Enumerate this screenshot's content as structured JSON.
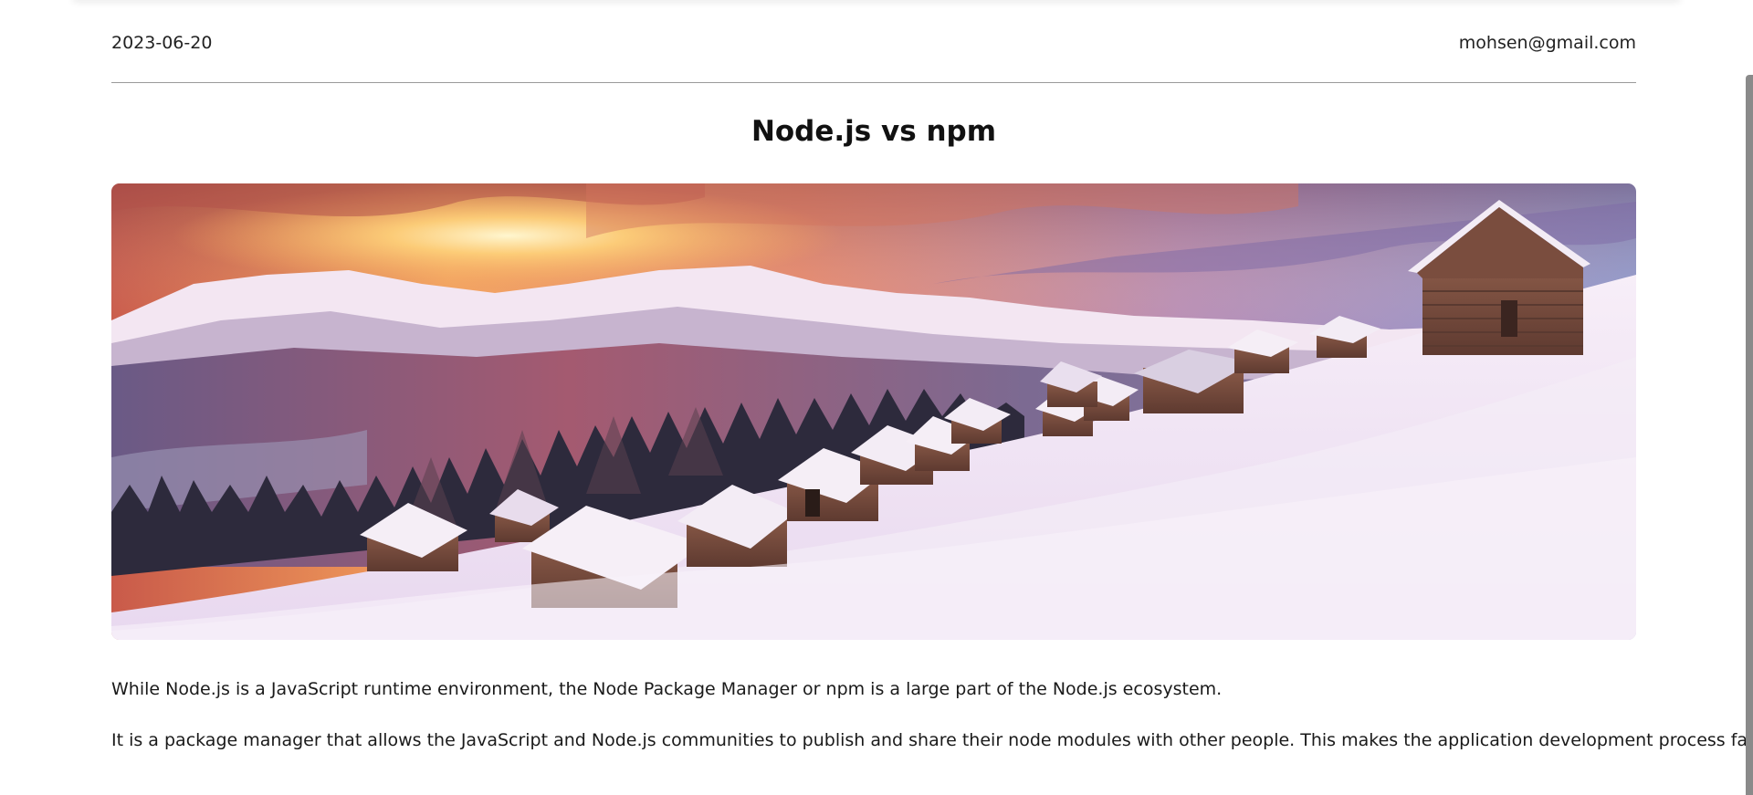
{
  "post": {
    "date": "2023-06-20",
    "author_email": "mohsen@gmail.com",
    "title": "Node.js vs npm",
    "hero_image": {
      "icon": "winter-mountain-cabins-image"
    },
    "paragraphs": [
      "While Node.js is a JavaScript runtime environment, the Node Package Manager or npm is a large part of the Node.js ecosystem.",
      "It is a package manager that allows the JavaScript and Node.js communities to publish and share their node modules with other people. This makes the application development process faster and more e"
    ]
  },
  "colors": {
    "divider": "#9a9a9a",
    "scrollbar": "#8a8a8a",
    "text": "#1a1a1a"
  }
}
